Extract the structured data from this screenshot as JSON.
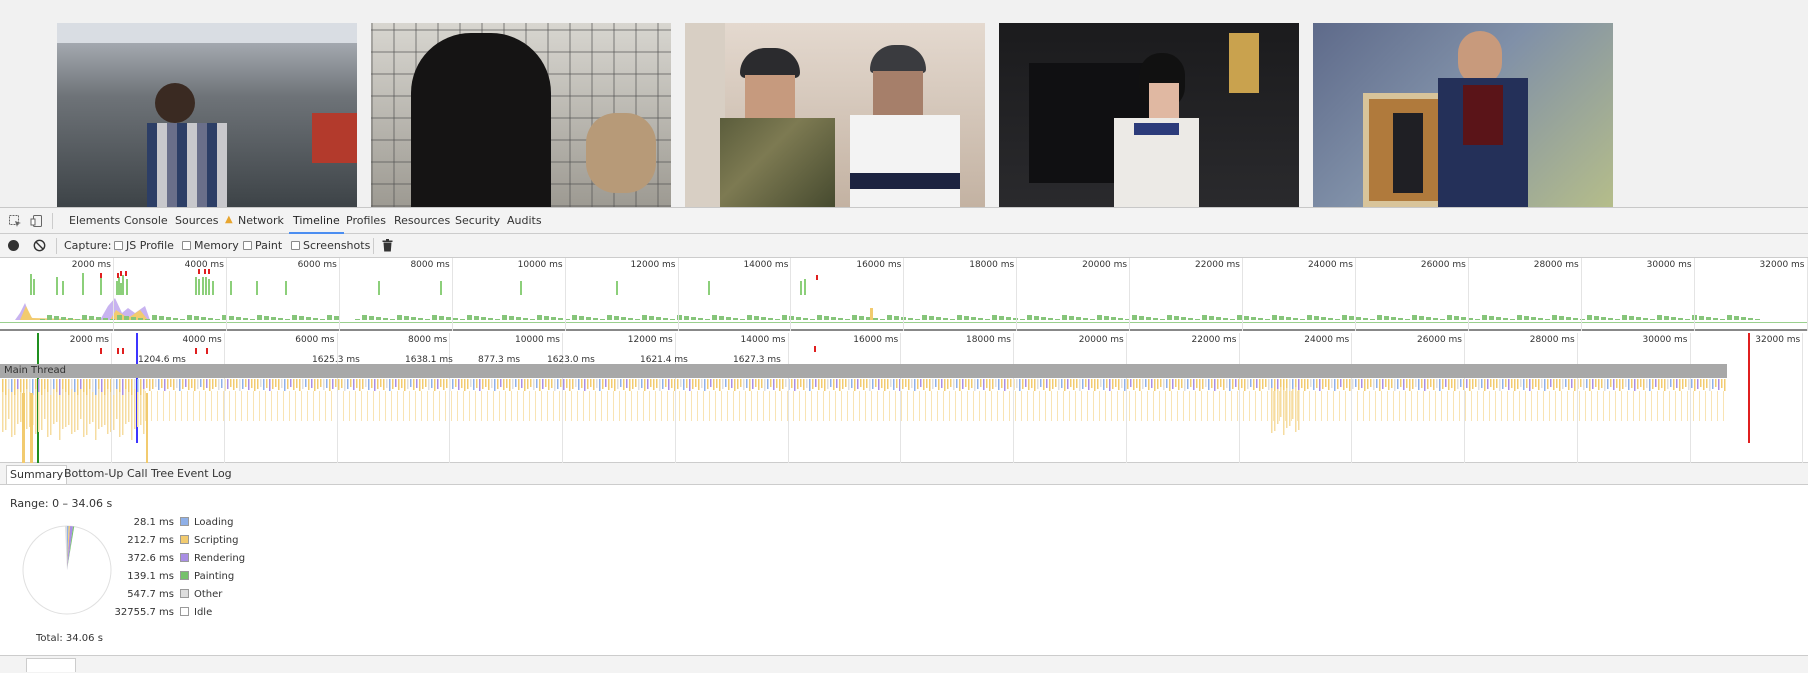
{
  "devtools": {
    "tabs": [
      "Elements",
      "Console",
      "Sources",
      "Network",
      "Timeline",
      "Profiles",
      "Resources",
      "Security",
      "Audits"
    ],
    "active_tab": "Timeline",
    "warning_tab": "Network",
    "toolbar": {
      "capture_label": "Capture:",
      "options": [
        {
          "label": "JS Profile",
          "checked": false
        },
        {
          "label": "Memory",
          "checked": false
        },
        {
          "label": "Paint",
          "checked": false
        },
        {
          "label": "Screenshots",
          "checked": false
        }
      ]
    },
    "overview_ticks": [
      "2000 ms",
      "4000 ms",
      "6000 ms",
      "8000 ms",
      "10000 ms",
      "12000 ms",
      "14000 ms",
      "16000 ms",
      "18000 ms",
      "20000 ms",
      "22000 ms",
      "24000 ms",
      "26000 ms",
      "28000 ms",
      "30000 ms",
      "32000 ms"
    ],
    "flame_ticks": [
      "2000 ms",
      "4000 ms",
      "6000 ms",
      "8000 ms",
      "10000 ms",
      "12000 ms",
      "14000 ms",
      "16000 ms",
      "18000 ms",
      "20000 ms",
      "22000 ms",
      "24000 ms",
      "26000 ms",
      "28000 ms",
      "30000 ms",
      "32000 ms"
    ],
    "frame_durations": [
      "1204.6 ms",
      "1625.3 ms",
      "1638.1 ms",
      "877.3 ms",
      "1623.0 ms",
      "1621.4 ms",
      "1627.3 ms"
    ],
    "main_thread_label": "Main Thread",
    "bottom_tabs": [
      "Summary",
      "Bottom-Up",
      "Call Tree",
      "Event Log"
    ],
    "active_bottom_tab": "Summary",
    "summary": {
      "range": "Range: 0 – 34.06 s",
      "rows": [
        {
          "value": "28.1 ms",
          "label": "Loading",
          "color": "#8fb0e8"
        },
        {
          "value": "212.7 ms",
          "label": "Scripting",
          "color": "#f2cb6f"
        },
        {
          "value": "372.6 ms",
          "label": "Rendering",
          "color": "#a98ee4"
        },
        {
          "value": "139.1 ms",
          "label": "Painting",
          "color": "#76c16c"
        },
        {
          "value": "547.7 ms",
          "label": "Other",
          "color": "#dedede"
        },
        {
          "value": "32755.7 ms",
          "label": "Idle",
          "color": "#ffffff"
        }
      ],
      "total": "Total: 34.06 s"
    }
  }
}
